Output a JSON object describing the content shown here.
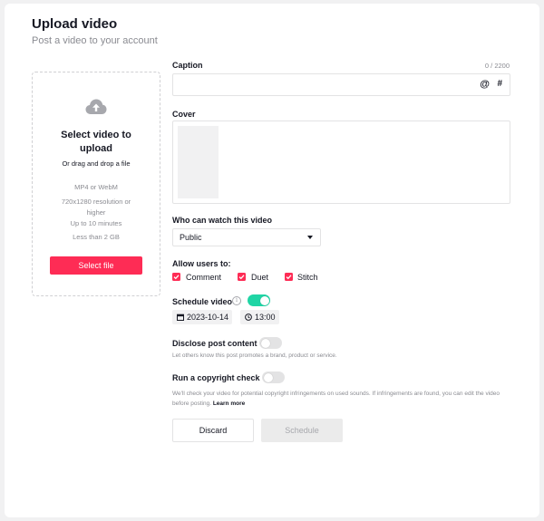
{
  "header": {
    "title": "Upload video",
    "subtitle": "Post a video to your account"
  },
  "upload": {
    "icon": "cloud-upload-icon",
    "title": "Select video to upload",
    "drag_text": "Or drag and drop a file",
    "specs": [
      "MP4 or WebM",
      "720x1280 resolution or higher",
      "Up to 10 minutes",
      "Less than 2 GB"
    ],
    "button_label": "Select file"
  },
  "caption": {
    "label": "Caption",
    "counter": "0 / 2200",
    "value": "",
    "mention_symbol": "@",
    "hashtag_symbol": "#"
  },
  "cover": {
    "label": "Cover"
  },
  "privacy": {
    "label": "Who can watch this video",
    "selected": "Public"
  },
  "allow": {
    "label": "Allow users to:",
    "options": [
      {
        "label": "Comment",
        "checked": true
      },
      {
        "label": "Duet",
        "checked": true
      },
      {
        "label": "Stitch",
        "checked": true
      }
    ]
  },
  "schedule": {
    "label": "Schedule video",
    "enabled": true,
    "date": "2023-10-14",
    "time": "13:00"
  },
  "disclose": {
    "label": "Disclose post content",
    "enabled": false,
    "description": "Let others know this post promotes a brand, product or service."
  },
  "copyright": {
    "label": "Run a copyright check",
    "enabled": false,
    "description": "We'll check your video for potential copyright infringements on used sounds. If infringements are found, you can edit the video before posting.",
    "learn_more": "Learn more"
  },
  "actions": {
    "discard_label": "Discard",
    "schedule_label": "Schedule"
  },
  "colors": {
    "accent": "#fe2c55",
    "toggle_on": "#20d5a5",
    "muted_text": "#8a8b91"
  }
}
